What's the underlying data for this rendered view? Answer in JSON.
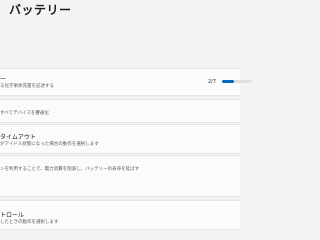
{
  "page": {
    "title": "バッテリー"
  },
  "battery_usage": {
    "title": "ー",
    "description": "る化学果体充量を記述する",
    "count": "2/7",
    "fill_fraction": 0.4
  },
  "cards": [
    {
      "title": "",
      "description": "すべてデバイスを響通化"
    },
    {
      "title": "タイムアウト",
      "description": "がアイドル状態になった場合の動作を選択します"
    },
    {
      "title": "",
      "description": "ンを利用することで、電力消費を削減し、バッテリーの寿命を延ばす"
    },
    {
      "title": "トロール",
      "description": "したときの動作を選択します"
    }
  ]
}
